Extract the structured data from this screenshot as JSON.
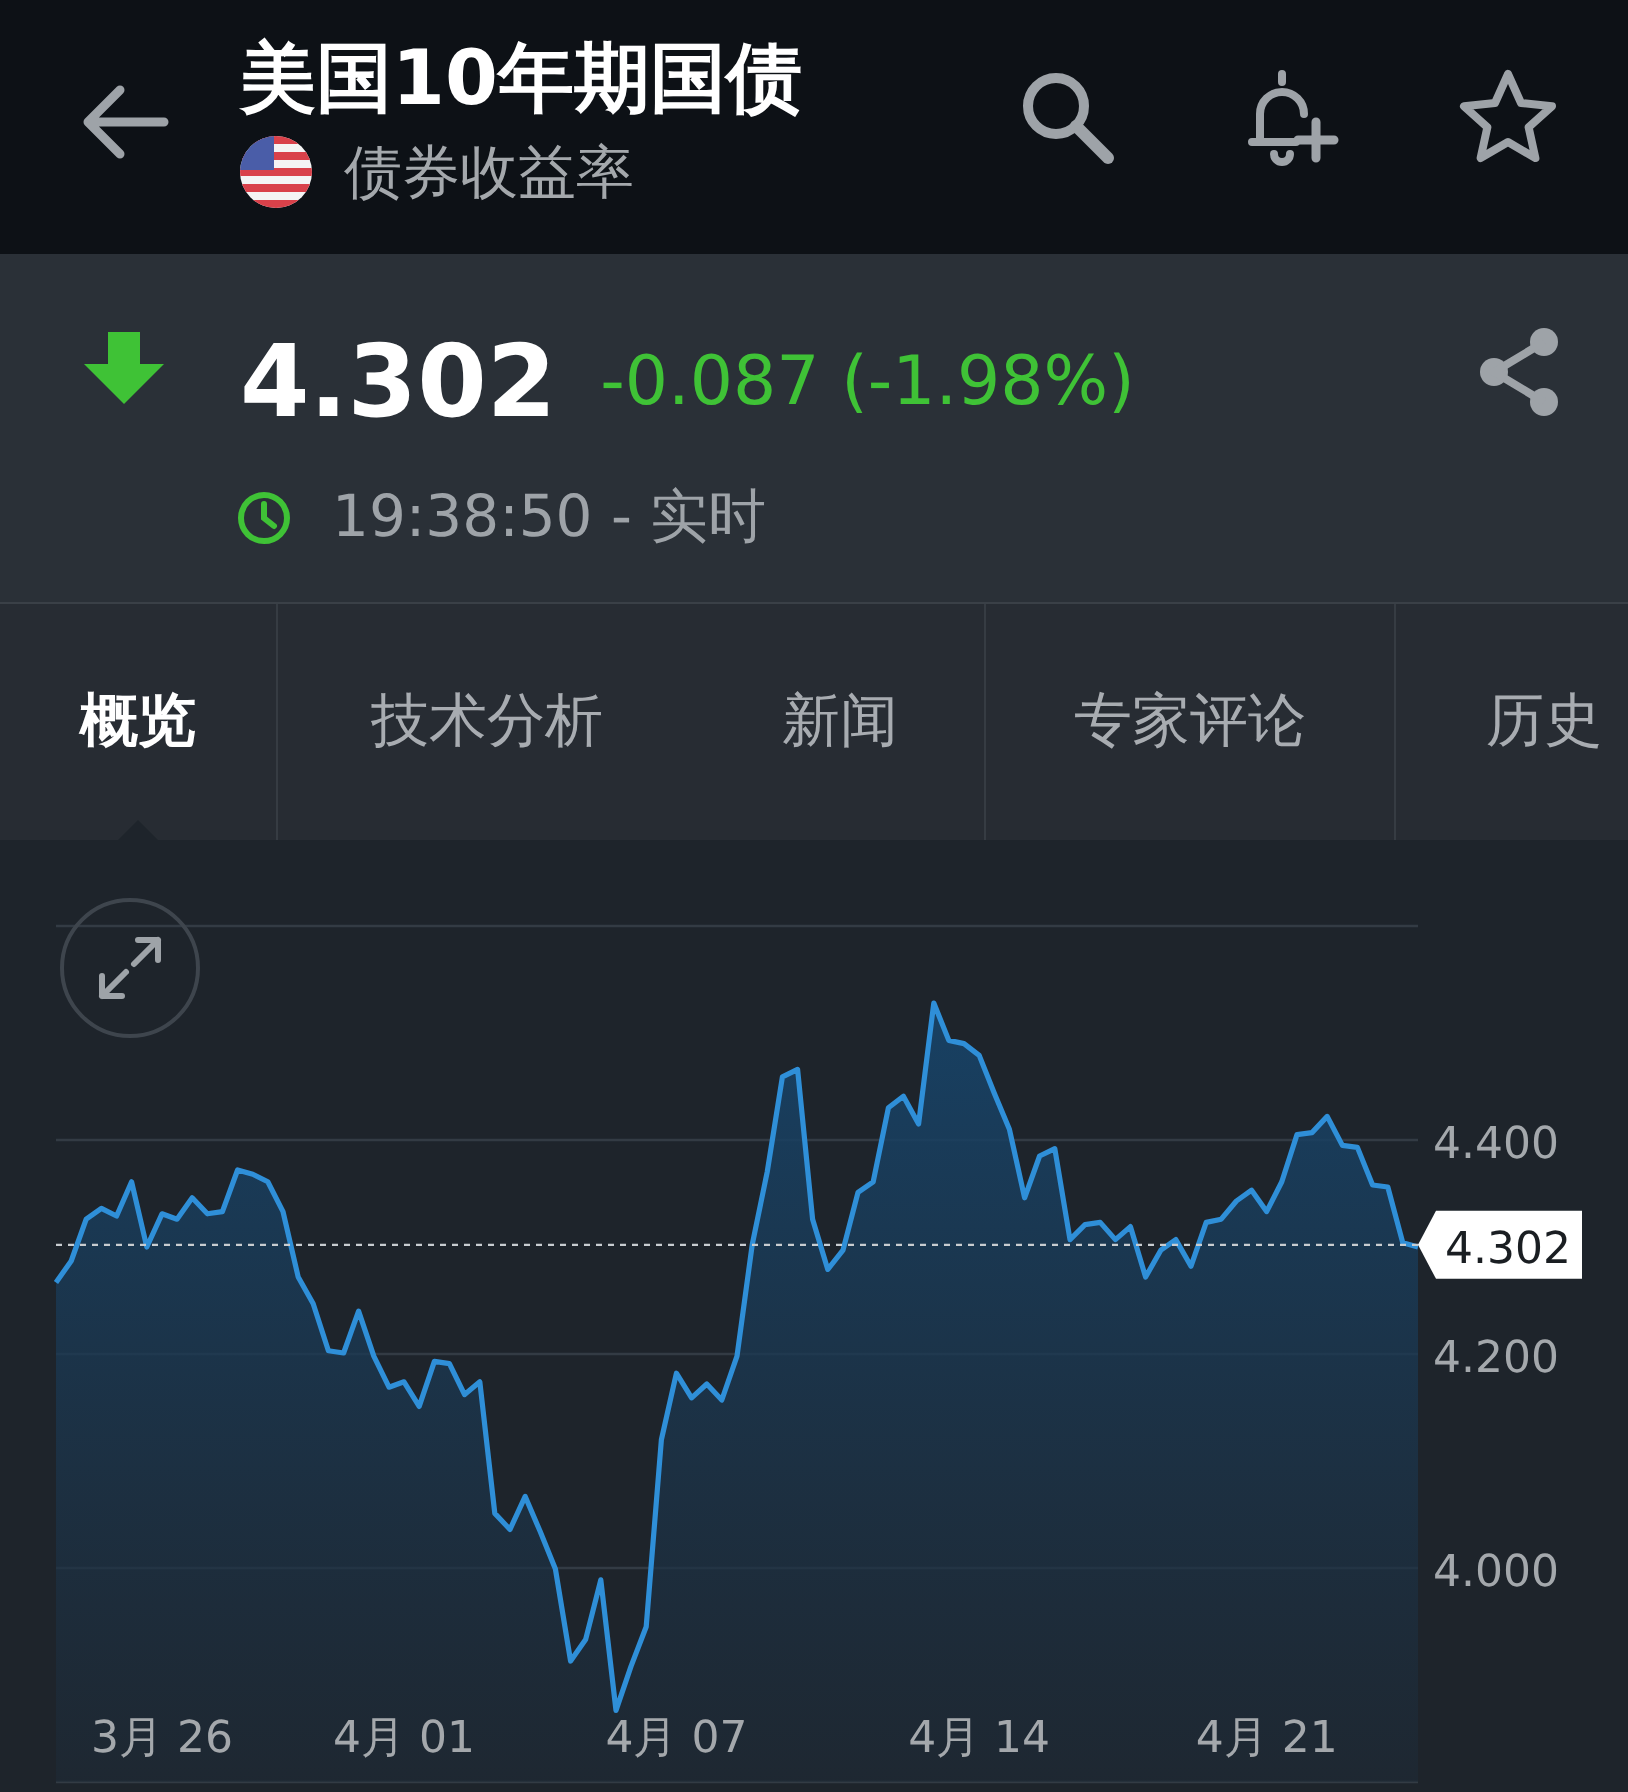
{
  "header": {
    "title": "美国10年期国债",
    "subtitle": "债券收益率"
  },
  "quote": {
    "falling": true,
    "price": "4.302",
    "change": "-0.087 (-1.98%)",
    "time": "19:38:50 - 实时"
  },
  "tabs": [
    {
      "label": "概览",
      "selected": true
    },
    {
      "label": "技术分析",
      "selected": false
    },
    {
      "label": "新闻",
      "selected": false
    },
    {
      "label": "专家评论",
      "selected": false
    },
    {
      "label": "历史",
      "selected": false
    }
  ],
  "chart": {
    "chart_data": {
      "type": "area",
      "grid": true,
      "ylim": [
        3.8,
        4.6
      ],
      "yticks": [
        {
          "value": 4.0,
          "label": "4.000"
        },
        {
          "value": 4.2,
          "label": "4.200"
        },
        {
          "value": 4.4,
          "label": "4.400"
        }
      ],
      "categories": [
        null,
        null,
        null,
        null,
        null,
        null,
        null,
        "3月 26",
        null,
        null,
        null,
        null,
        null,
        null,
        null,
        null,
        null,
        null,
        null,
        null,
        null,
        null,
        null,
        "4月 01",
        null,
        null,
        null,
        null,
        null,
        null,
        null,
        null,
        null,
        null,
        null,
        null,
        null,
        null,
        null,
        null,
        null,
        "4月 07",
        null,
        null,
        null,
        null,
        null,
        null,
        null,
        null,
        null,
        null,
        null,
        null,
        null,
        null,
        null,
        null,
        null,
        null,
        null,
        "4月 14",
        null,
        null,
        null,
        null,
        null,
        null,
        null,
        null,
        null,
        null,
        null,
        null,
        null,
        null,
        null,
        null,
        null,
        null,
        "4月 21",
        null,
        null,
        null,
        null,
        null,
        null,
        null,
        null,
        null,
        null
      ],
      "series": [
        {
          "color": "#2f8fd8",
          "values": [
            4.267,
            4.287,
            4.326,
            4.336,
            4.329,
            4.361,
            4.3,
            4.331,
            4.326,
            4.346,
            4.331,
            4.333,
            4.372,
            4.368,
            4.361,
            4.333,
            4.272,
            4.247,
            4.203,
            4.201,
            4.24,
            4.198,
            4.169,
            4.174,
            4.151,
            4.193,
            4.191,
            4.162,
            4.174,
            4.051,
            4.036,
            4.067,
            4.034,
            3.999,
            3.913,
            3.933,
            3.989,
            3.867,
            3.908,
            3.945,
            4.12,
            4.182,
            4.159,
            4.172,
            4.157,
            4.198,
            4.302,
            4.37,
            4.459,
            4.466,
            4.326,
            4.279,
            4.297,
            4.351,
            4.361,
            4.43,
            4.441,
            4.415,
            4.528,
            4.493,
            4.49,
            4.479,
            4.444,
            4.41,
            4.346,
            4.385,
            4.392,
            4.307,
            4.321,
            4.323,
            4.307,
            4.319,
            4.272,
            4.297,
            4.307,
            4.282,
            4.323,
            4.326,
            4.343,
            4.353,
            4.333,
            4.361,
            4.405,
            4.407,
            4.422,
            4.395,
            4.393,
            4.358,
            4.356,
            4.304,
            4.3
          ]
        }
      ],
      "ref_lines": [
        {
          "axis": "y",
          "value": 4.302,
          "label": "4.302"
        }
      ]
    }
  }
}
